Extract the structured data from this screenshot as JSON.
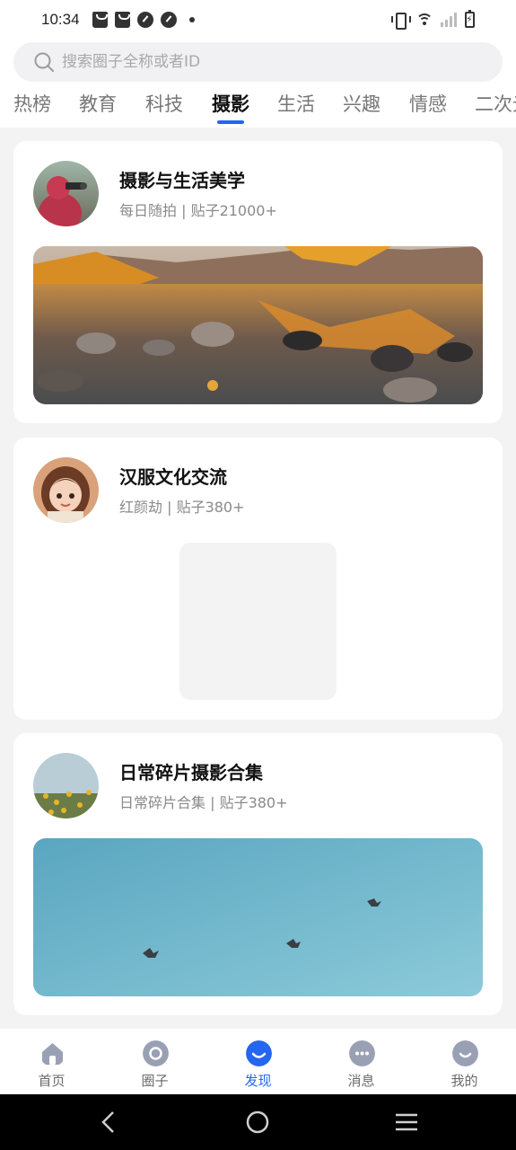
{
  "status_bar": {
    "time": "10:34"
  },
  "search": {
    "placeholder": "搜索圈子全称或者ID"
  },
  "tabs": [
    "热榜",
    "教育",
    "科技",
    "摄影",
    "生活",
    "兴趣",
    "情感",
    "二次元"
  ],
  "active_tab": "摄影",
  "cards": [
    {
      "title": "摄影与生活美学",
      "subtitle": "每日随拍 | 贴子21000+"
    },
    {
      "title": "汉服文化交流",
      "subtitle": "红颜劫 | 贴子380+"
    },
    {
      "title": "日常碎片摄影合集",
      "subtitle": "日常碎片合集 | 贴子380+"
    }
  ],
  "bottom_nav": [
    {
      "label": "首页",
      "icon": "home-icon"
    },
    {
      "label": "圈子",
      "icon": "circle-icon"
    },
    {
      "label": "发现",
      "icon": "discover-icon"
    },
    {
      "label": "消息",
      "icon": "message-icon"
    },
    {
      "label": "我的",
      "icon": "profile-icon"
    }
  ],
  "active_nav": "发现",
  "colors": {
    "accent": "#2466f0",
    "background": "#f3f3f3",
    "muted_text": "#8a8a8a"
  }
}
